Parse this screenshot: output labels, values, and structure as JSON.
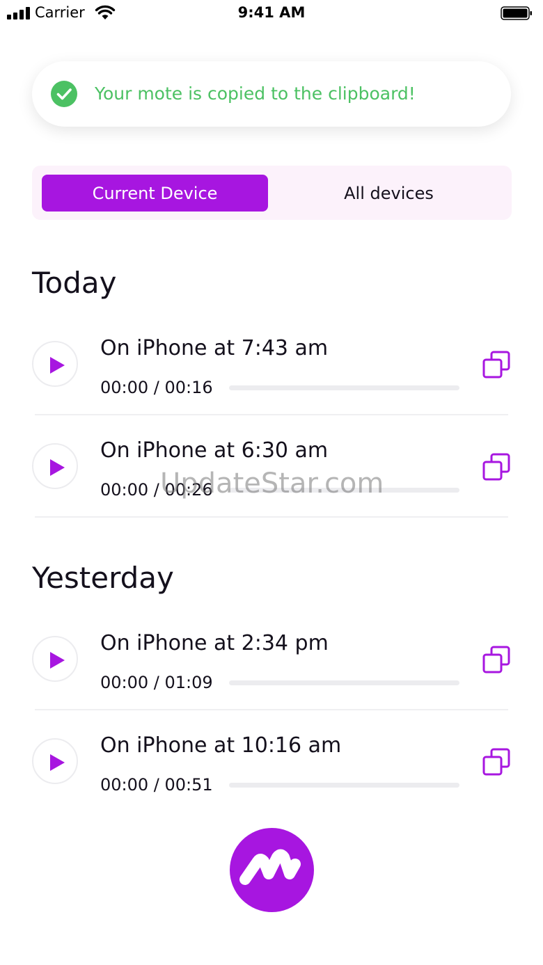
{
  "status_bar": {
    "carrier": "Carrier",
    "time": "9:41 AM"
  },
  "toast": {
    "message": "Your mote is copied to the clipboard!",
    "icon": "check-circle-icon"
  },
  "tabs": {
    "current": "Current Device",
    "all": "All devices",
    "selected": "Current Device"
  },
  "sections": [
    {
      "title": "Today",
      "recordings": [
        {
          "title": "On iPhone at 7:43 am",
          "time": "00:00 / 00:16",
          "progress": 0
        },
        {
          "title": "On iPhone at 6:30 am",
          "time": "00:00 / 00:26",
          "progress": 0
        }
      ]
    },
    {
      "title": "Yesterday",
      "recordings": [
        {
          "title": "On iPhone at 2:34 pm",
          "time": "00:00 / 01:09",
          "progress": 0
        },
        {
          "title": "On iPhone at 10:16 am",
          "time": "00:00 / 00:51",
          "progress": 0
        }
      ]
    }
  ],
  "watermark": "UpdateStar.com",
  "colors": {
    "accent": "#a716e0",
    "success": "#4cc163",
    "segment_bg": "#fcf2fb"
  },
  "icons": {
    "play": "play-icon",
    "copy": "copy-icon",
    "record": "mote-logo-icon"
  }
}
